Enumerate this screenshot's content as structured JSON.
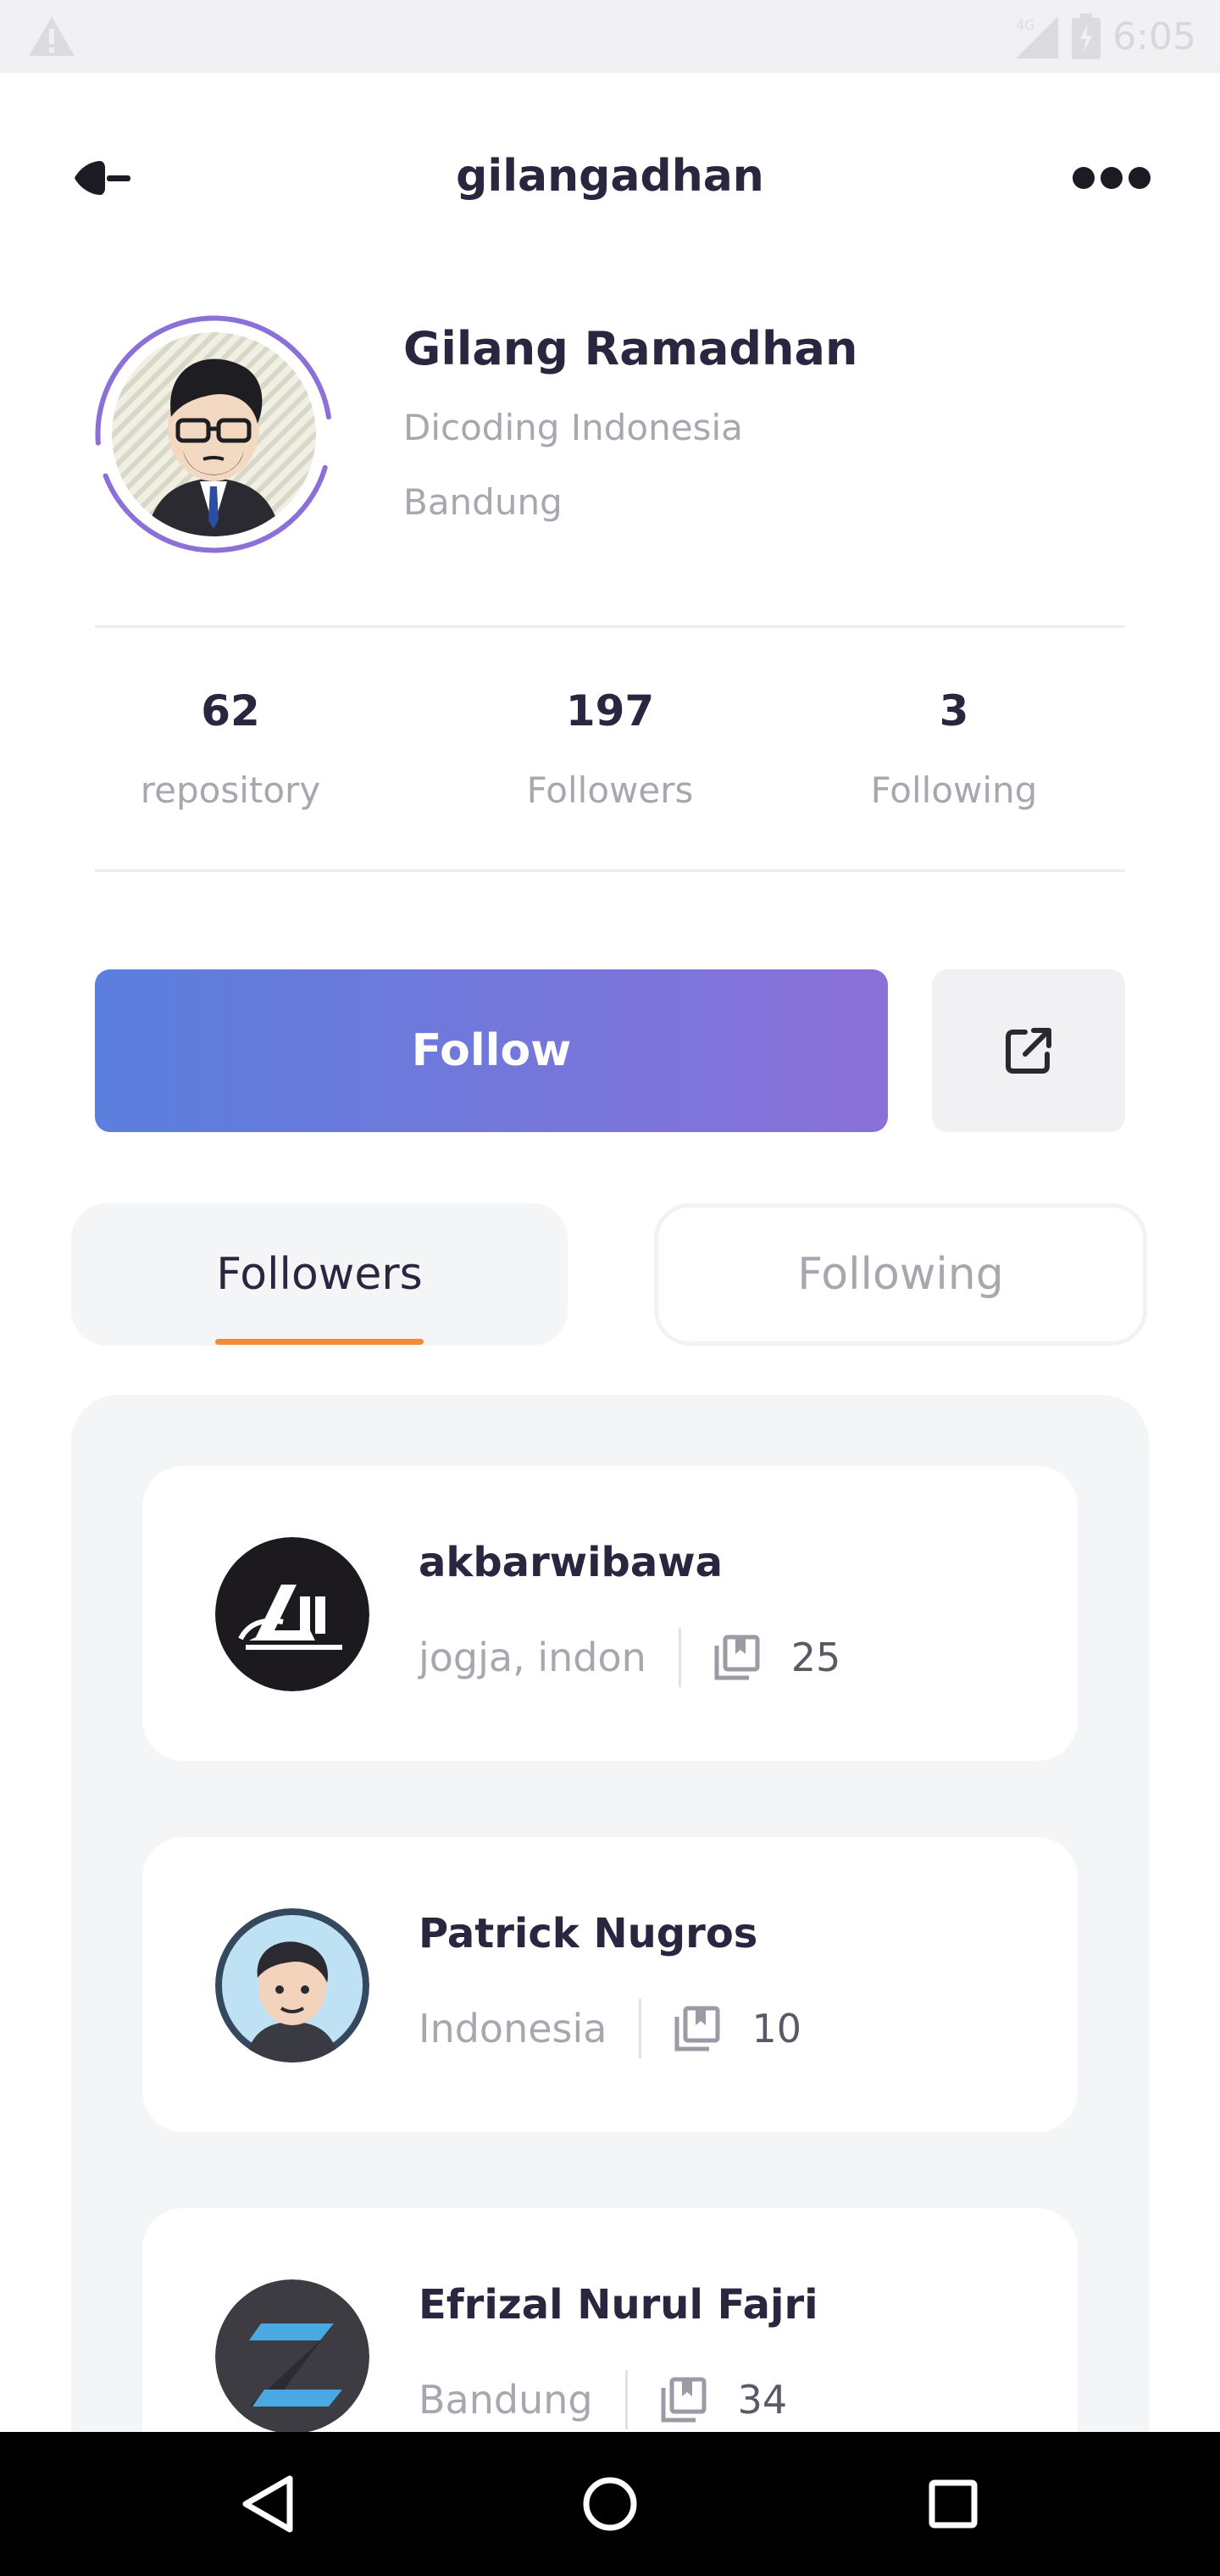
{
  "status_bar": {
    "time": "6:05",
    "network": "4G",
    "icons": [
      "warning-icon",
      "signal-icon",
      "battery-icon"
    ]
  },
  "header": {
    "title": "gilangadhan",
    "back_icon": "back-arrow-icon",
    "more_icon": "more-options-icon"
  },
  "profile": {
    "name": "Gilang Ramadhan",
    "company": "Dicoding Indonesia",
    "location": "Bandung",
    "ring_color": "#8a70d8"
  },
  "stats": [
    {
      "value": "62",
      "label": "repository"
    },
    {
      "value": "197",
      "label": "Followers"
    },
    {
      "value": "3",
      "label": "Following"
    }
  ],
  "actions": {
    "follow_label": "Follow",
    "share_icon": "external-link-icon",
    "gradient": [
      "#5b7fdd",
      "#8a70d8"
    ]
  },
  "tabs": [
    {
      "label": "Followers",
      "active": true
    },
    {
      "label": "Following",
      "active": false
    }
  ],
  "accent_color": "#f28c38",
  "followers": [
    {
      "name": "akbarwibawa",
      "location": "jogja, indon",
      "repos": "25"
    },
    {
      "name": "Patrick Nugros",
      "location": "Indonesia",
      "repos": "10"
    },
    {
      "name": "Efrizal Nurul Fajri",
      "location": "Bandung",
      "repos": "34"
    }
  ],
  "nav_bar": {
    "icons": [
      "nav-back-icon",
      "nav-home-icon",
      "nav-recents-icon"
    ]
  }
}
